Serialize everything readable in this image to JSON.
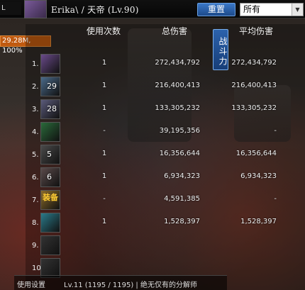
{
  "topbar": {
    "left_tag": "L",
    "character_name": "Erika\\ / 天帝 (Lv.90)",
    "reset_button": "重置",
    "filter_select": "所有"
  },
  "badge": "29.28M, 100%",
  "side_tab": "战斗力",
  "columns": {
    "use_count": "使用次数",
    "total_damage": "总伤害",
    "avg_damage": "平均伤害"
  },
  "rows": [
    {
      "rank": "1.",
      "level": "",
      "use": "1",
      "total": "272,434,792",
      "avg": "272,434,792",
      "color": "#6a4a8a"
    },
    {
      "rank": "2.",
      "level": "29",
      "use": "1",
      "total": "216,400,413",
      "avg": "216,400,413",
      "color": "#4a6a8a"
    },
    {
      "rank": "3.",
      "level": "28",
      "use": "1",
      "total": "133,305,232",
      "avg": "133,305,232",
      "color": "#5a5a7a"
    },
    {
      "rank": "4.",
      "level": "",
      "use": "-",
      "total": "39,195,356",
      "avg": "-",
      "color": "#2a6a3a"
    },
    {
      "rank": "5.",
      "level": "5",
      "use": "1",
      "total": "16,356,644",
      "avg": "16,356,644",
      "color": "#4a4a4a"
    },
    {
      "rank": "6.",
      "level": "6",
      "use": "1",
      "total": "6,934,323",
      "avg": "6,934,323",
      "color": "#5a4a4a"
    },
    {
      "rank": "7.",
      "level": "",
      "use": "-",
      "total": "4,591,385",
      "avg": "-",
      "color": "#8a6a2a"
    },
    {
      "rank": "8.",
      "level": "",
      "use": "1",
      "total": "1,528,397",
      "avg": "1,528,397",
      "color": "#2a7a8a"
    },
    {
      "rank": "9.",
      "level": "",
      "use": "",
      "total": "",
      "avg": "",
      "color": "#333333"
    },
    {
      "rank": "10.",
      "level": "",
      "use": "",
      "total": "",
      "avg": "",
      "color": "#333333"
    }
  ],
  "equip_label": "装备",
  "bottom": {
    "left": "使用设置",
    "mid": "Lv.11 (1195 / 1195) | 绝无仅有的分解师"
  }
}
